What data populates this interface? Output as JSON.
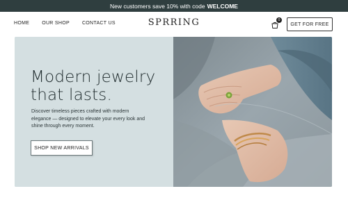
{
  "promo": {
    "text": "New customers save 10% with code",
    "code": "WELCOME"
  },
  "nav": {
    "links": [
      "HOME",
      "OUR SHOP",
      "CONTACT US"
    ],
    "logo": "SPRRING",
    "cart_count": "0",
    "cta_label": "GET FOR FREE"
  },
  "hero": {
    "title_line1": "Modern jewelry",
    "title_line2": "that lasts.",
    "description": "Discover timeless pieces crafted with modern elegance — designed to elevate your every look and shine through every moment.",
    "button_label": "SHOP NEW ARRIVALS"
  },
  "colors": {
    "promo_bg": "#2f3e3f",
    "hero_bg": "#d4dfe1",
    "text_dark": "#1e2a2c"
  },
  "icons": {
    "cart": "shopping-bag-icon"
  }
}
